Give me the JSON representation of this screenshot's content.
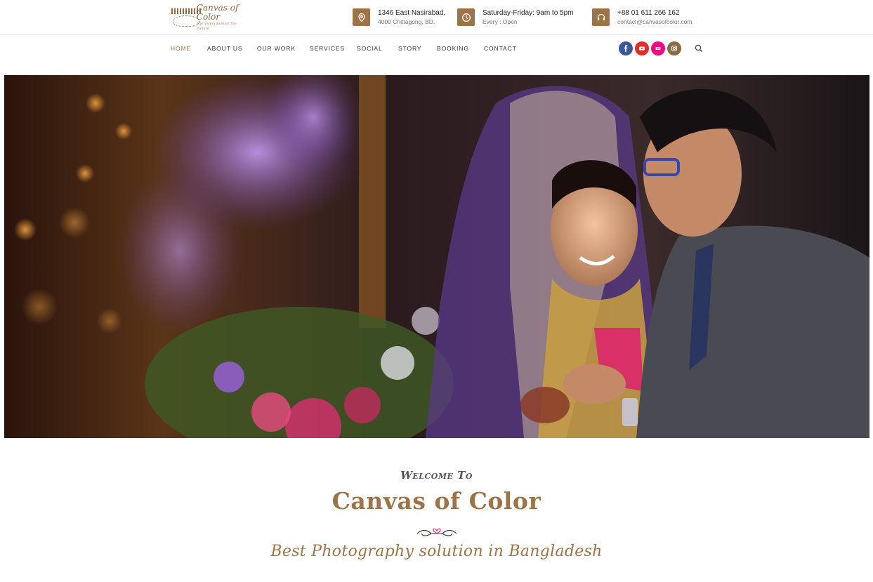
{
  "brand": {
    "logo_name": "Canvas of Color",
    "logo_tagline": "The Vision Behind The Picture"
  },
  "contact_info": [
    {
      "icon": "map-pin-icon",
      "line1": "1346 East Nasirabad,",
      "line2": "4000 Chittagong, BD."
    },
    {
      "icon": "clock-icon",
      "line1": "Saturday-Friday: 9am to 5pm",
      "line2": "Every : Open"
    },
    {
      "icon": "headset-icon",
      "line1": "+88 01 611 266 162",
      "line2": "contact@canvasofcolor.com"
    }
  ],
  "nav": {
    "items": [
      {
        "label": "HOME",
        "active": true
      },
      {
        "label": "ABOUT US"
      },
      {
        "label": "OUR WORK"
      },
      {
        "label": "SERVICES"
      },
      {
        "label": "SOCIAL"
      },
      {
        "label": "STORY"
      },
      {
        "label": "BOOKING"
      },
      {
        "label": "CONTACT"
      }
    ],
    "social": [
      {
        "icon": "facebook-icon",
        "color": "#3b5998"
      },
      {
        "icon": "youtube-icon",
        "color": "#e52d27"
      },
      {
        "icon": "flickr-icon",
        "color": "#ff0084"
      },
      {
        "icon": "instagram-icon",
        "color": "#8a6a45"
      }
    ],
    "search_icon": "search-icon"
  },
  "colors": {
    "accent": "#9c7448",
    "text_dark": "#222222"
  },
  "intro": {
    "welcome": "Welcome To",
    "title": "Canvas of Color",
    "tagline": "Best Photography solution in Bangladesh"
  }
}
